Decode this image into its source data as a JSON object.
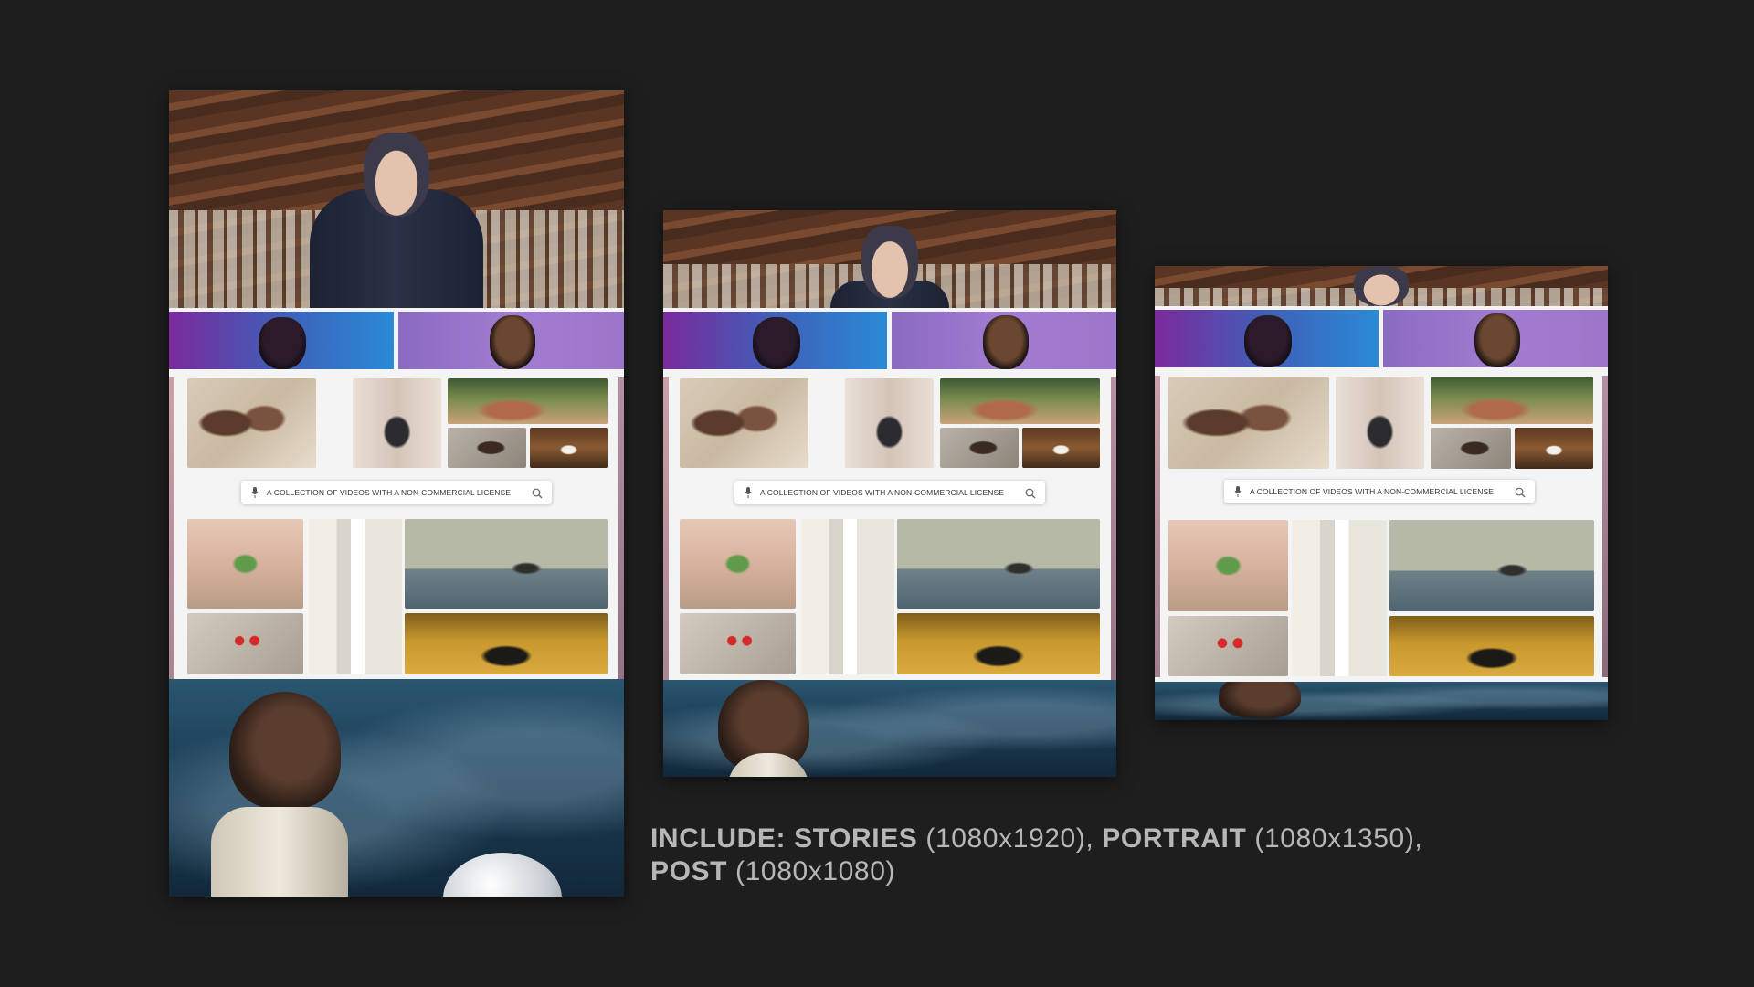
{
  "search": {
    "text": "A COLLECTION OF VIDEOS WITH A NON-COMMERCIAL LICENSE"
  },
  "caption": {
    "include_label": "INCLUDE:",
    "stories_label": "STORIES",
    "stories_size": "(1080x1920),",
    "portrait_label": "PORTRAIT",
    "portrait_size": "(1080x1350),",
    "post_label": "POST",
    "post_size": "(1080x1080)"
  },
  "icons": {
    "mic": "microphone-icon",
    "search": "search-icon"
  },
  "colors": {
    "background": "#1e1e1f",
    "caption": "#b7b7b7"
  }
}
